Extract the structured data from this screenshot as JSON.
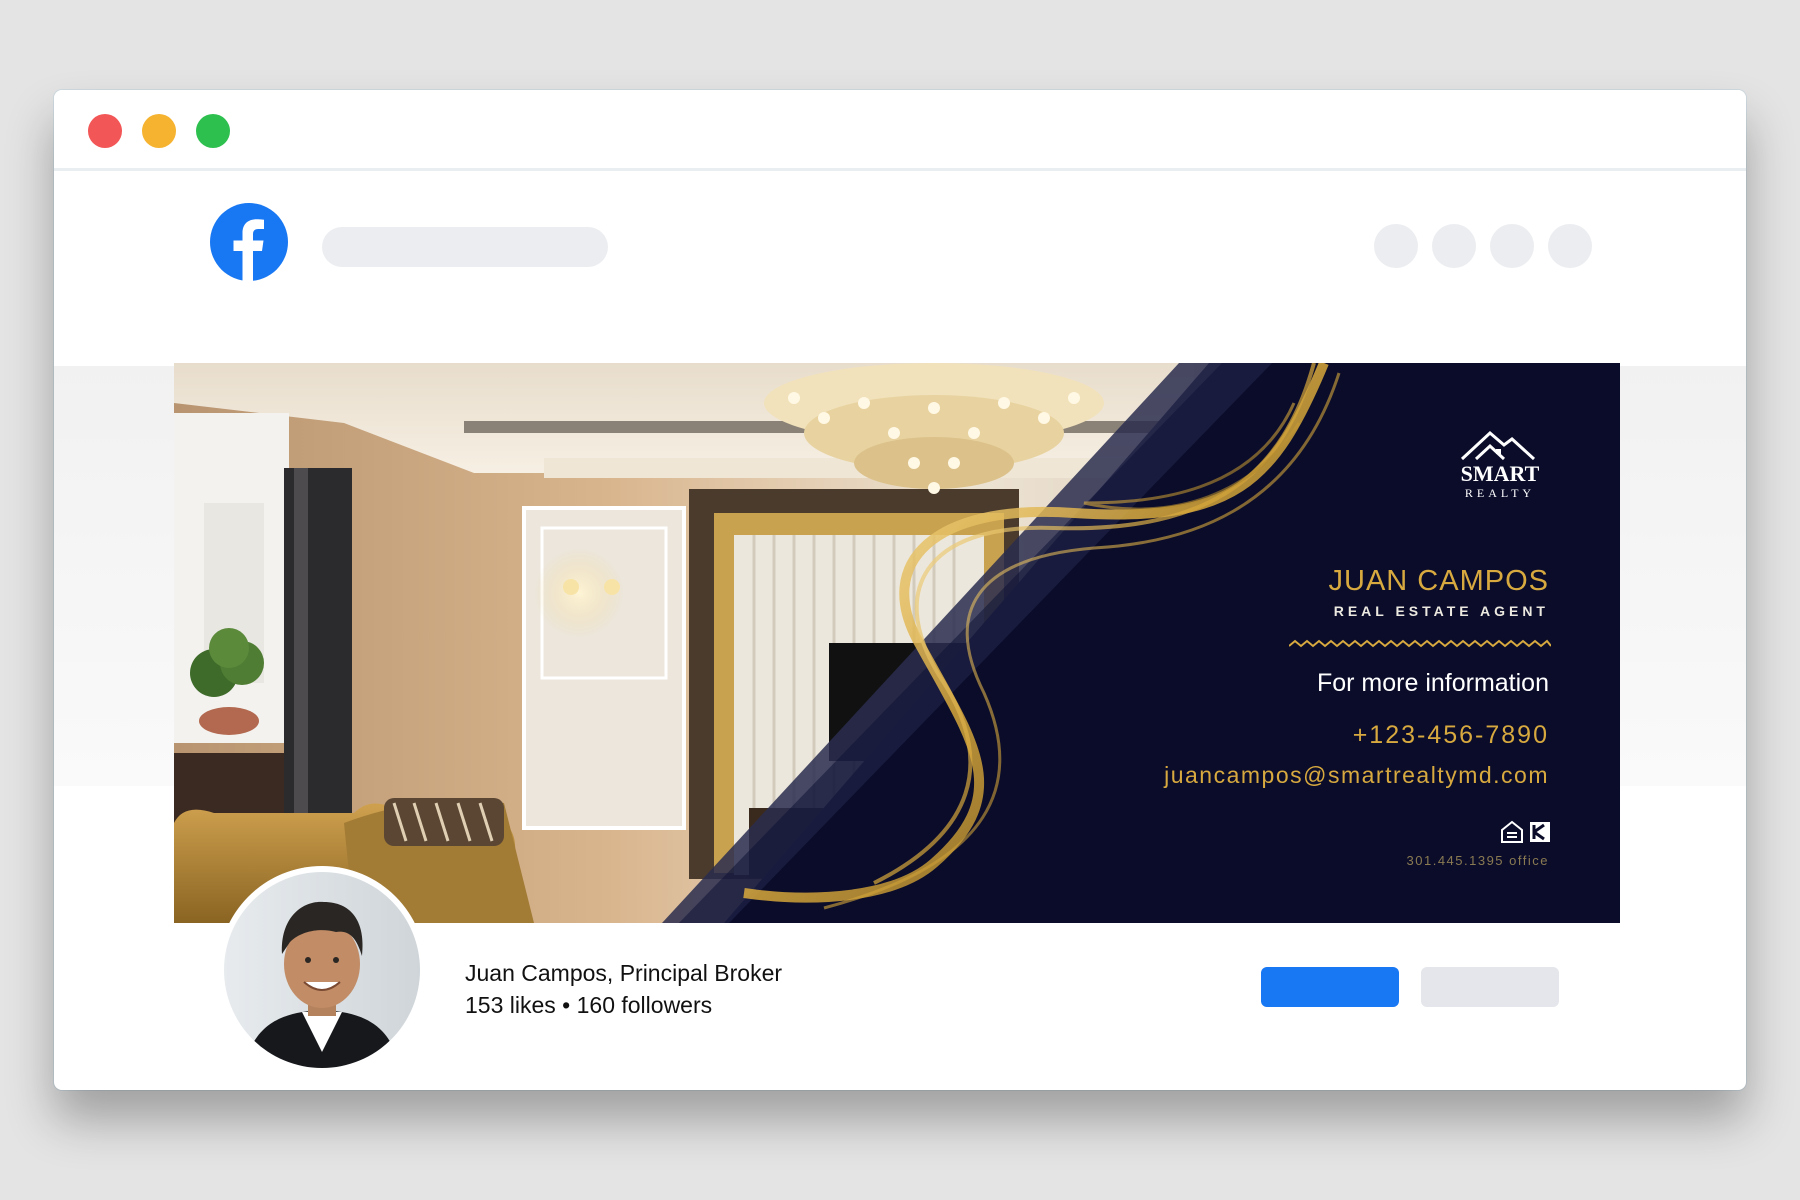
{
  "window": {
    "controls": [
      "close",
      "minimize",
      "maximize"
    ]
  },
  "header": {
    "logo_icon": "facebook-logo-icon",
    "brand_color": "#1877f2"
  },
  "cover": {
    "brand_logo_text": [
      "SMART",
      "REALTY"
    ],
    "agent_name": "JUAN CAMPOS",
    "agent_title": "REAL ESTATE AGENT",
    "info_heading": "For more information",
    "phone": "+123-456-7890",
    "email": "juancampos@smartrealtymd.com",
    "office_phone": "301.445.1395 office",
    "accent_color": "#d7a93f",
    "panel_color": "#0a0c2a"
  },
  "profile": {
    "page_name": "Juan Campos, Principal Broker",
    "stats": "153 likes • 160 followers",
    "avatar_icon": "profile-photo"
  }
}
